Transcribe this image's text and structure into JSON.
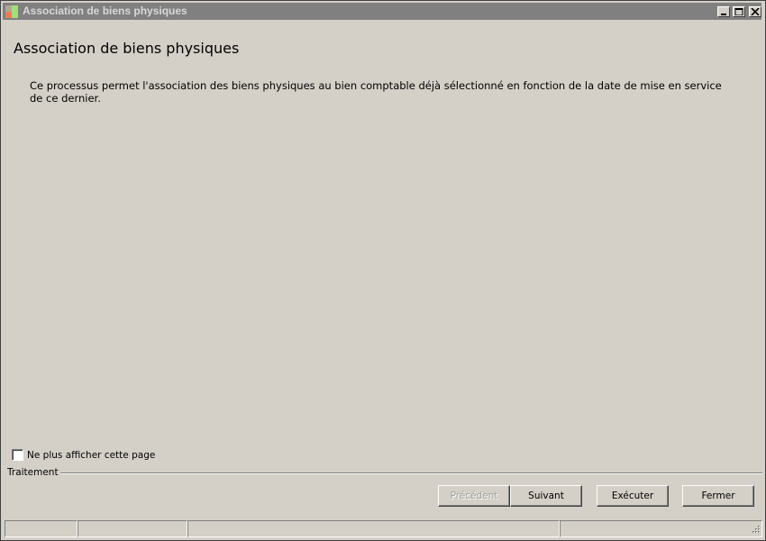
{
  "window": {
    "title": "Association de biens physiques",
    "icon": "app-logo-icon"
  },
  "title_buttons": {
    "minimize_icon": "minimize-icon",
    "maximize_icon": "maximize-icon",
    "close_icon": "close-icon"
  },
  "main": {
    "page_title": "Association de biens physiques",
    "description": "Ce processus permet l'association des biens physiques au bien comptable déjà sélectionné en fonction de la date de mise en service de ce dernier."
  },
  "options": {
    "hide_page_label": "Ne plus afficher cette page",
    "hide_page_checked": false
  },
  "footer": {
    "group_label": "Traitement",
    "buttons": {
      "previous": "Précédent",
      "next": "Suivant",
      "execute": "Exécuter",
      "close": "Fermer"
    },
    "previous_disabled": true
  },
  "statusbar": {
    "cells": [
      "",
      "",
      "",
      ""
    ]
  },
  "colors": {
    "background": "#d4d0c8",
    "titlebar": "#808080",
    "title_text": "#d8d8d8",
    "disabled_text": "#a0a0a0"
  }
}
